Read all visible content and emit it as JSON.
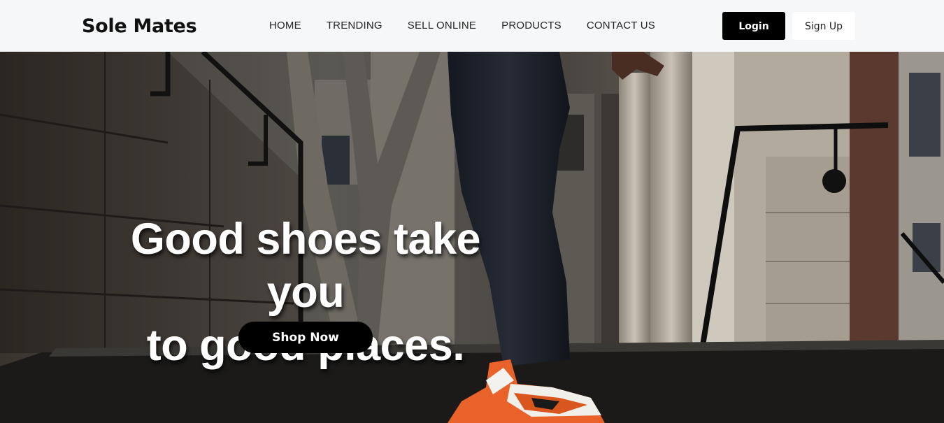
{
  "navbar": {
    "brand": "Sole Mates",
    "links": [
      {
        "label": "HOME"
      },
      {
        "label": "TRENDING"
      },
      {
        "label": "SELL ONLINE"
      },
      {
        "label": "PRODUCTS"
      },
      {
        "label": "CONTACT US"
      }
    ],
    "login_label": "Login",
    "signup_label": "Sign Up"
  },
  "hero": {
    "headline_line1": "Good shoes take you",
    "headline_line2": "to good places.",
    "cta_label": "Shop Now"
  },
  "colors": {
    "navbar_bg": "#f6f7f9",
    "primary_button": "#000000",
    "sneaker_accent": "#e8622a"
  }
}
